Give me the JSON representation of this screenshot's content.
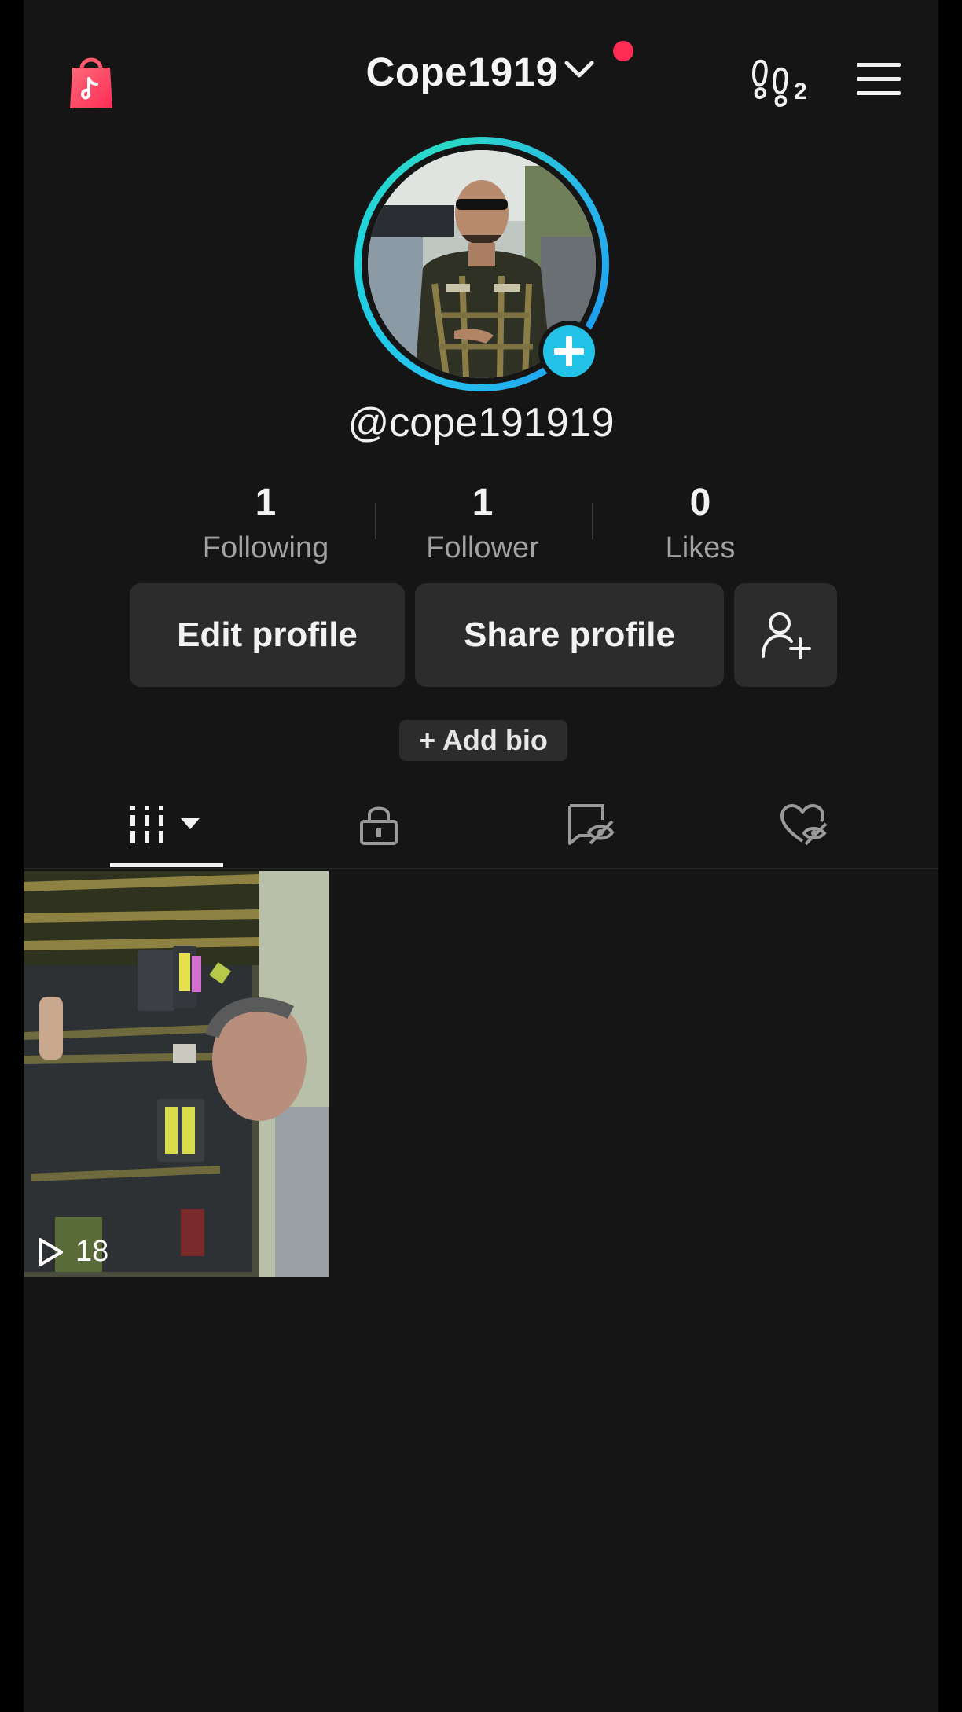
{
  "header": {
    "username": "Cope1919",
    "footprint_count": "2",
    "icons": {
      "shop": "shop-bag-icon",
      "dropdown": "chevron-down-icon",
      "footprints": "footprint-icon",
      "menu": "hamburger-menu-icon"
    }
  },
  "profile": {
    "handle": "@cope191919"
  },
  "stats": [
    {
      "value": "1",
      "label": "Following"
    },
    {
      "value": "1",
      "label": "Follower"
    },
    {
      "value": "0",
      "label": "Likes"
    }
  ],
  "actions": {
    "edit_profile": "Edit profile",
    "share_profile": "Share profile",
    "add_bio": "+ Add bio"
  },
  "tabs": [
    {
      "name": "videos",
      "icon": "grid-icon",
      "active": true
    },
    {
      "name": "private",
      "icon": "lock-icon",
      "active": false
    },
    {
      "name": "reposts",
      "icon": "repost-hidden-icon",
      "active": false
    },
    {
      "name": "liked",
      "icon": "heart-hidden-icon",
      "active": false
    }
  ],
  "videos": [
    {
      "views": "18"
    }
  ],
  "colors": {
    "background": "#151515",
    "button": "#2c2c2c",
    "accent_cyan": "#22c3e6",
    "notification": "#fe2c55"
  }
}
